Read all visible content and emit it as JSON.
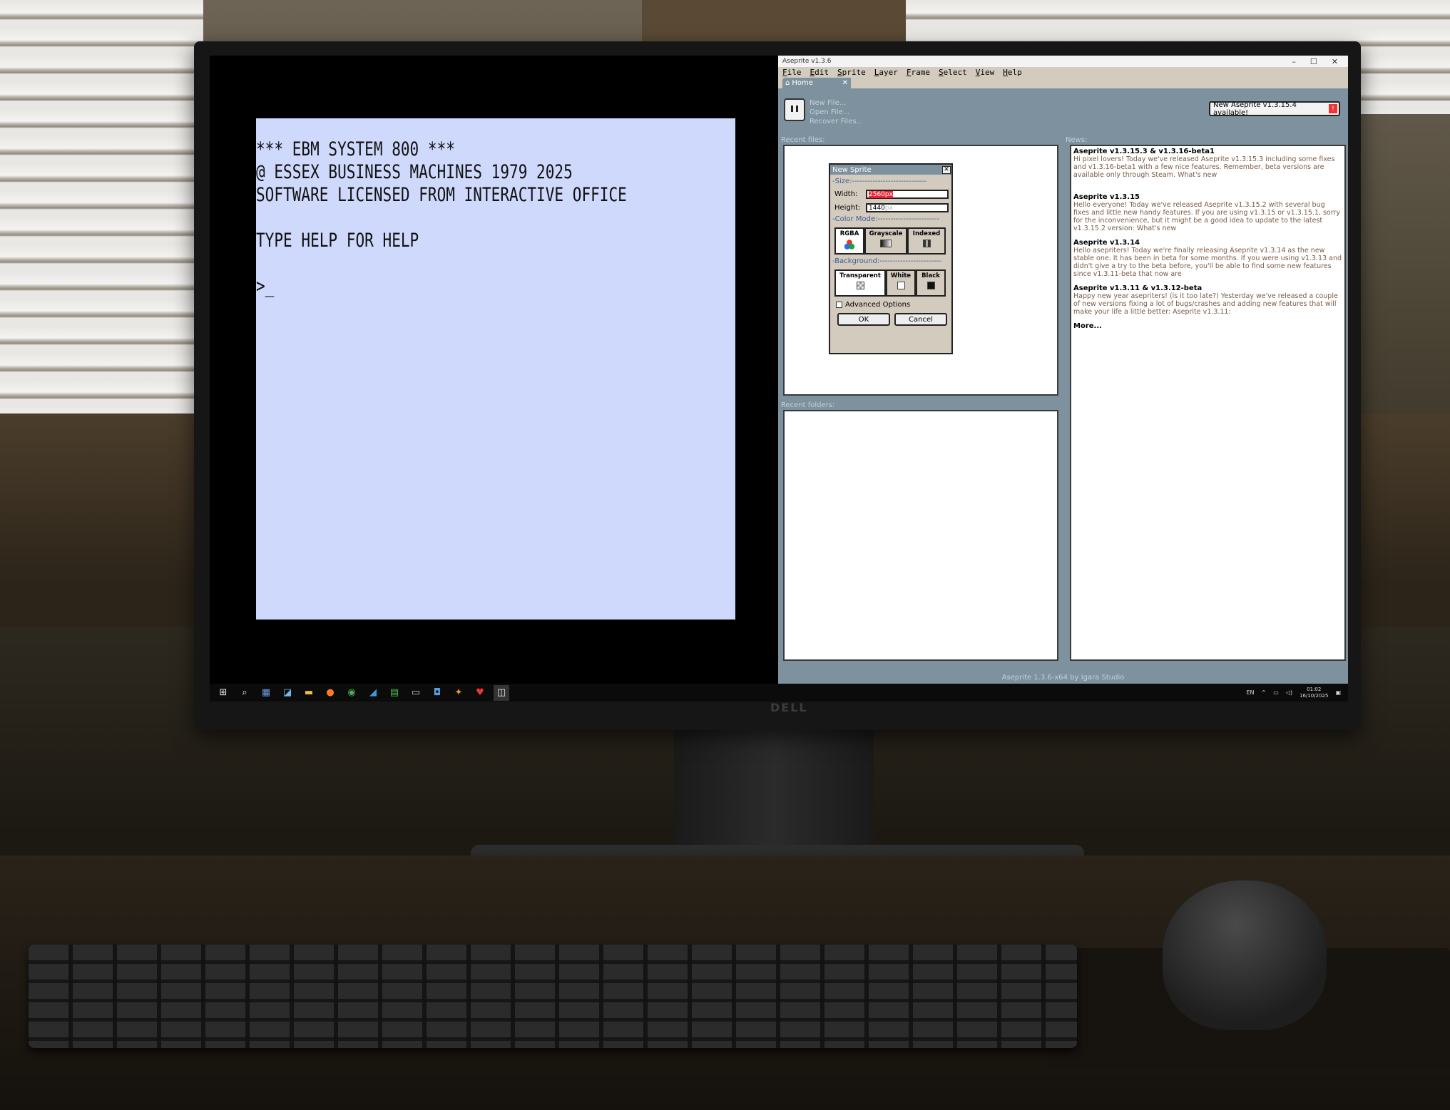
{
  "monitor": {
    "brand": "DELL"
  },
  "terminal": {
    "lines": [
      "*** EBM SYSTEM 800 ***",
      "@ ESSEX BUSINESS MACHINES 1979 2025",
      "SOFTWARE LICENSED FROM INTERACTIVE OFFICE",
      "",
      "TYPE HELP FOR HELP",
      "",
      ">_"
    ]
  },
  "aseprite": {
    "window_title": "Aseprite v1.3.6",
    "menu": [
      "File",
      "Edit",
      "Sprite",
      "Layer",
      "Frame",
      "Select",
      "View",
      "Help"
    ],
    "tab_label": "Home",
    "home_links": [
      "New File...",
      "Open File...",
      "Recover Files..."
    ],
    "update_button": "New Aseprite v1.3.15.4 available!",
    "update_badge": "!",
    "recent_files_label": "Recent files:",
    "recent_folders_label": "Recent folders:",
    "news_label": "News:",
    "news": [
      {
        "title": "Aseprite v1.3.15.3 & v1.3.16-beta1",
        "body": "Hi pixel lovers! Today we've released Aseprite v1.3.15.3 including some fixes and v1.3.16-beta1 with a few nice features. Remember, beta versions are available only through Steam. What's new"
      },
      {
        "title": "Aseprite v1.3.15",
        "body": "Hello everyone! Today we've released Aseprite v1.3.15.2 with several bug fixes and little new handy features. If you are using v1.3.15 or v1.3.15.1, sorry for the inconvenience, but it might be a good idea to update to the latest v1.3.15.2 version: What's new"
      },
      {
        "title": "Aseprite v1.3.14",
        "body": "Hello asepriters! Today we're finally releasing Aseprite v1.3.14 as the new stable one. It has been in beta for some months. If you were using v1.3.13 and didn't give a try to the beta before, you'll be able to find some new features since v1.3.11-beta that now are"
      },
      {
        "title": "Aseprite v1.3.11 & v1.3.12-beta",
        "body": "Happy new year asepriters! (is it too late?) Yesterday we've released a couple of new versions fixing a lot of bugs/crashes and adding new features that will make your life a little better: Aseprite v1.3.11:"
      }
    ],
    "news_more": "More...",
    "status_text": "Aseprite 1.3.6-x64 by Igara Studio",
    "dialog": {
      "title": "New Sprite",
      "size_section": "Size:",
      "width_label": "Width:",
      "width_value": "2560",
      "height_label": "Height:",
      "height_value": "1440",
      "unit": "px",
      "color_mode_section": "Color Mode:",
      "color_modes": [
        "RGBA",
        "Grayscale",
        "Indexed"
      ],
      "background_section": "Background:",
      "backgrounds": [
        "Transparent",
        "White",
        "Black"
      ],
      "advanced_label": "Advanced Options",
      "ok_label": "OK",
      "cancel_label": "Cancel"
    }
  },
  "taskbar": {
    "language": "EN",
    "time": "01:02",
    "date": "16/10/2025"
  }
}
